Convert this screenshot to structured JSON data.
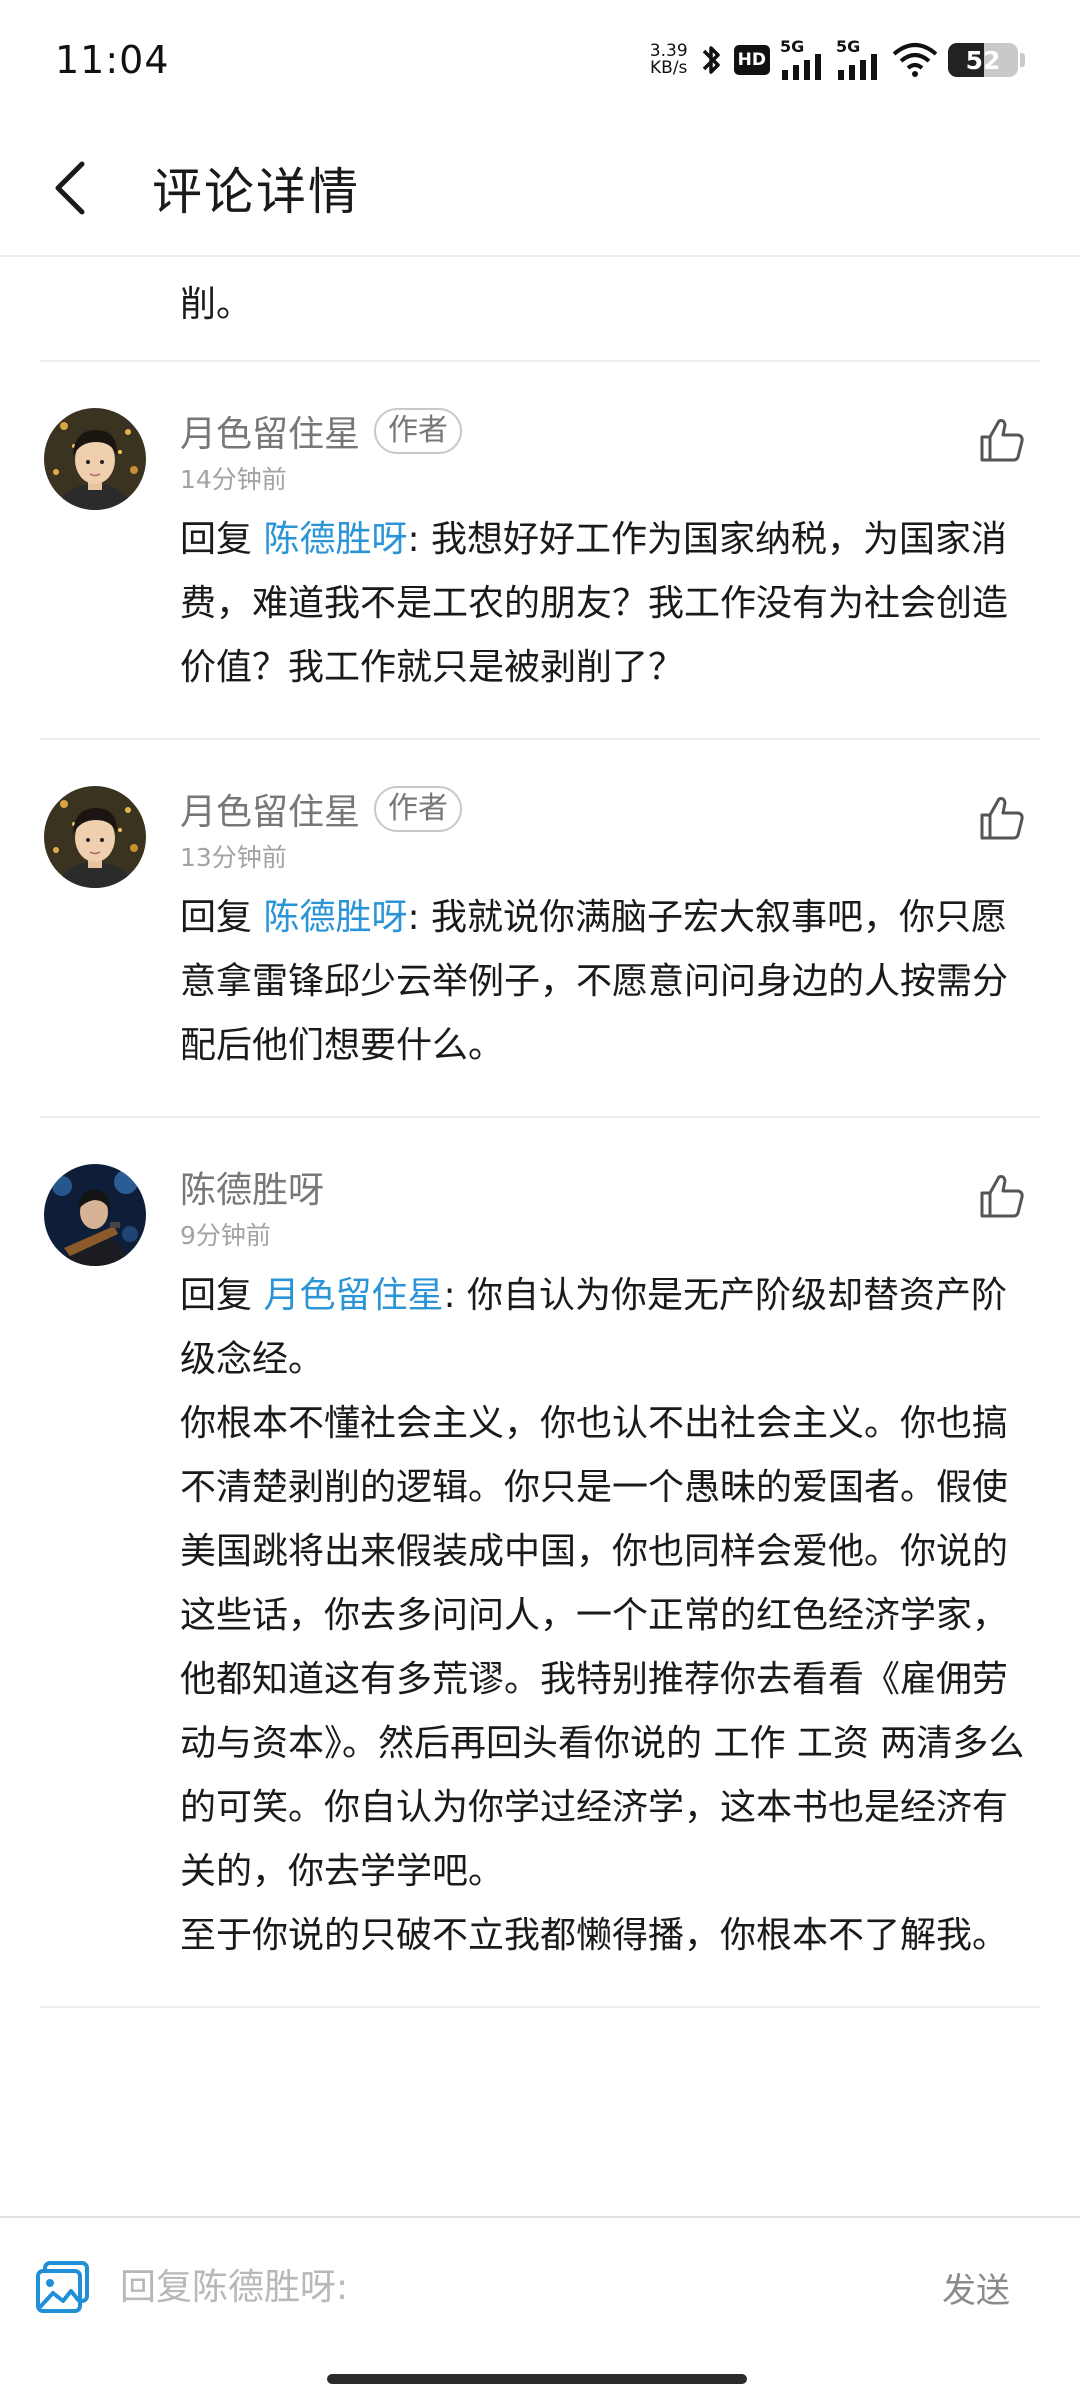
{
  "status_bar": {
    "time": "11:04",
    "net_speed_value": "3.39",
    "net_speed_unit": "KB/s",
    "hd_label": "HD",
    "signal1_label": "5G",
    "signal2_label": "5G",
    "battery": "52",
    "battery_level": 0.52
  },
  "header": {
    "title": "评论详情"
  },
  "fragment_text": "削。",
  "comments": [
    {
      "name": "月色留住星",
      "tag": "作者",
      "time": "14分钟前",
      "reply_prefix": "回复 ",
      "mention": "陈德胜呀",
      "text": ": 我想好好工作为国家纳税，为国家消费，难道我不是工农的朋友？我工作没有为社会创造价值？我工作就只是被剥削了？"
    },
    {
      "name": "月色留住星",
      "tag": "作者",
      "time": "13分钟前",
      "reply_prefix": "回复 ",
      "mention": "陈德胜呀",
      "text": ": 我就说你满脑子宏大叙事吧，你只愿意拿雷锋邱少云举例子，不愿意问问身边的人按需分配后他们想要什么。"
    },
    {
      "name": "陈德胜呀",
      "time": "9分钟前",
      "reply_prefix": "回复 ",
      "mention": "月色留住星",
      "text": ": 你自认为你是无产阶级却替资产阶级念经。\n你根本不懂社会主义，你也认不出社会主义。你也搞不清楚剥削的逻辑。你只是一个愚昧的爱国者。假使美国跳将出来假装成中国，你也同样会爱他。你说的这些话，你去多问问人，一个正常的红色经济学家，他都知道这有多荒谬。我特别推荐你去看看《雇佣劳动与资本》。然后再回头看你说的 工作 工资 两清多么的可笑。你自认为你学过经济学，这本书也是经济有关的，你去学学吧。\n至于你说的只破不立我都懒得播，你根本不了解我。"
    }
  ],
  "bottom_bar": {
    "placeholder": "回复陈德胜呀:",
    "send_label": "发送"
  },
  "colors": {
    "mention": "#2a94d6",
    "meta_gray": "#a3a3a3",
    "name_gray": "#777777"
  }
}
